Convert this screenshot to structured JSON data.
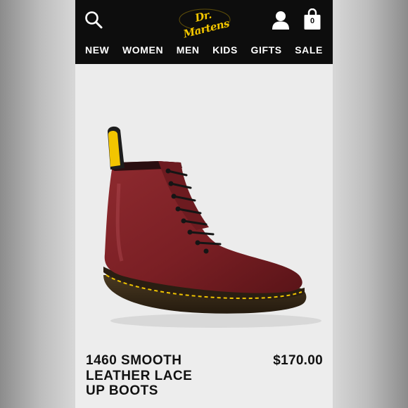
{
  "header": {
    "logo_text": "Dr. Martens",
    "icons": {
      "search": "search-icon",
      "account": "account-icon",
      "bag": "shopping-bag-icon"
    },
    "bag_count": "0"
  },
  "nav": {
    "items": [
      {
        "label": "NEW"
      },
      {
        "label": "WOMEN"
      },
      {
        "label": "MEN"
      },
      {
        "label": "KIDS"
      },
      {
        "label": "GIFTS"
      },
      {
        "label": "SALE"
      }
    ]
  },
  "product": {
    "title_lines": [
      "1460 SMOOTH",
      "LEATHER LACE",
      "UP BOOTS"
    ],
    "price": "$170.00",
    "image_subject": "cherry red leather 8-eye boot"
  },
  "colors": {
    "header_bg": "#0d0d0d",
    "logo_yellow": "#f5c800",
    "boot_leather": "#7a1f24",
    "page_bg": "#ededed"
  }
}
